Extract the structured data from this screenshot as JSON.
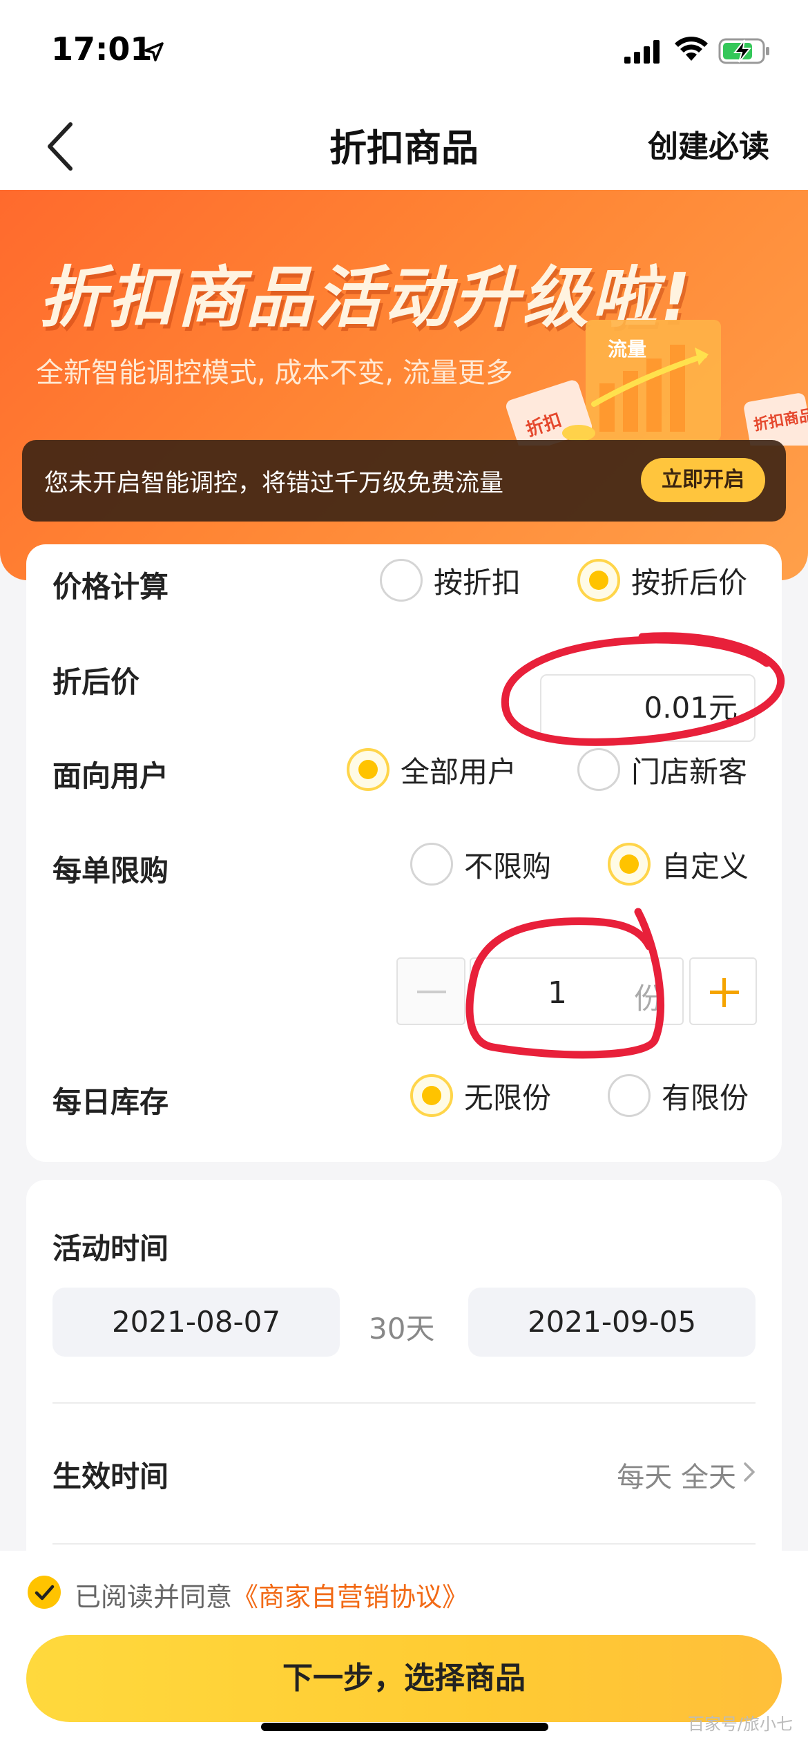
{
  "status_bar": {
    "time": "17:01"
  },
  "nav": {
    "title": "折扣商品",
    "right_link": "创建必读"
  },
  "banner": {
    "title": "折扣商品活动升级啦!",
    "subtitle": "全新智能调控模式, 成本不变, 流量更多",
    "deco_text_1": "流量",
    "deco_text_2": "折扣",
    "deco_text_3": "折扣商品",
    "notice": "您未开启智能调控，将错过千万级免费流量",
    "notice_button": "立即开启"
  },
  "form": {
    "price_calc": {
      "label": "价格计算",
      "options": [
        {
          "label": "按折扣",
          "selected": false
        },
        {
          "label": "按折后价",
          "selected": true
        }
      ]
    },
    "discounted_price": {
      "label": "折后价",
      "value": "0.01元"
    },
    "target_users": {
      "label": "面向用户",
      "options": [
        {
          "label": "全部用户",
          "selected": true
        },
        {
          "label": "门店新客",
          "selected": false
        }
      ]
    },
    "per_order_limit": {
      "label": "每单限购",
      "options": [
        {
          "label": "不限购",
          "selected": false
        },
        {
          "label": "自定义",
          "selected": true
        }
      ],
      "quantity": "1",
      "unit": "份"
    },
    "daily_stock": {
      "label": "每日库存",
      "options": [
        {
          "label": "无限份",
          "selected": true
        },
        {
          "label": "有限份",
          "selected": false
        }
      ]
    }
  },
  "activity": {
    "time_label": "活动时间",
    "start_date": "2021-08-07",
    "duration": "30天",
    "end_date": "2021-09-05",
    "effect_label": "生效时间",
    "effect_value": "每天 全天"
  },
  "footer": {
    "agree_prefix": "已阅读并同意",
    "agree_link": "《商家自营销协议》",
    "next_button": "下一步，选择商品",
    "watermark": "百家号/旅小七"
  },
  "colors": {
    "accent_yellow": "#ffc300",
    "banner_orange": "#ff6a2d",
    "link_orange": "#f26a16",
    "annotation_red": "#e8203a"
  }
}
